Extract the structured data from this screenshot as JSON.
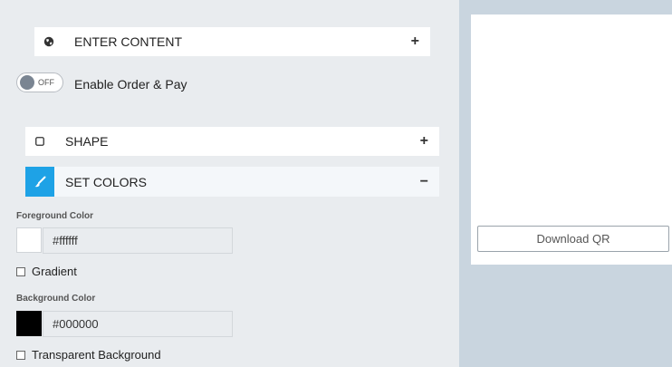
{
  "content": {
    "label": "ENTER CONTENT",
    "expand": "+"
  },
  "toggle": {
    "state": "OFF",
    "label": "Enable Order & Pay"
  },
  "shape": {
    "label": "SHAPE",
    "expand": "+"
  },
  "colors": {
    "label": "SET COLORS",
    "collapse": "−",
    "foreground_label": "Foreground Color",
    "foreground_value": "#ffffff",
    "gradient_label": "Gradient",
    "background_label": "Background Color",
    "background_value": "#000000",
    "transparent_label": "Transparent Background"
  },
  "preview": {
    "download_label": "Download QR"
  },
  "accent": "#1ea2e6"
}
